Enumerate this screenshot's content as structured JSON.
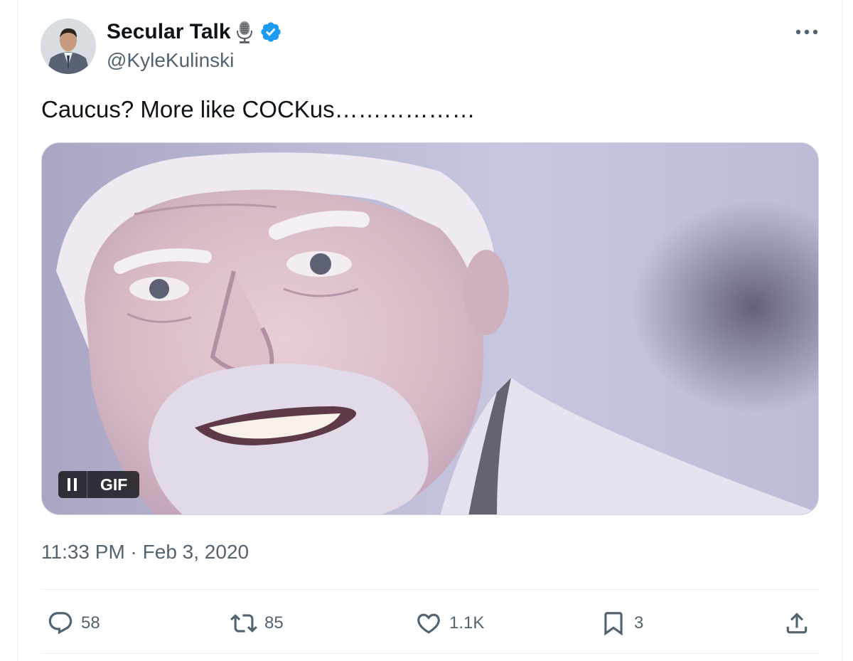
{
  "tweet": {
    "display_name": "Secular Talk",
    "name_emoji": "microphone-icon",
    "verified": true,
    "handle": "@KyleKulinski",
    "text": "Caucus? More like COCKus………………",
    "media": {
      "type": "GIF",
      "gif_label": "GIF",
      "control_icon": "pause-icon"
    },
    "timestamp": "11:33 PM · Feb 3, 2020",
    "actions": {
      "replies": "58",
      "reposts": "85",
      "likes": "1.1K",
      "bookmarks": "3"
    }
  },
  "colors": {
    "text": "#0f1419",
    "secondary": "#536471",
    "verified": "#1d9bf0",
    "border": "#eff3f4"
  }
}
